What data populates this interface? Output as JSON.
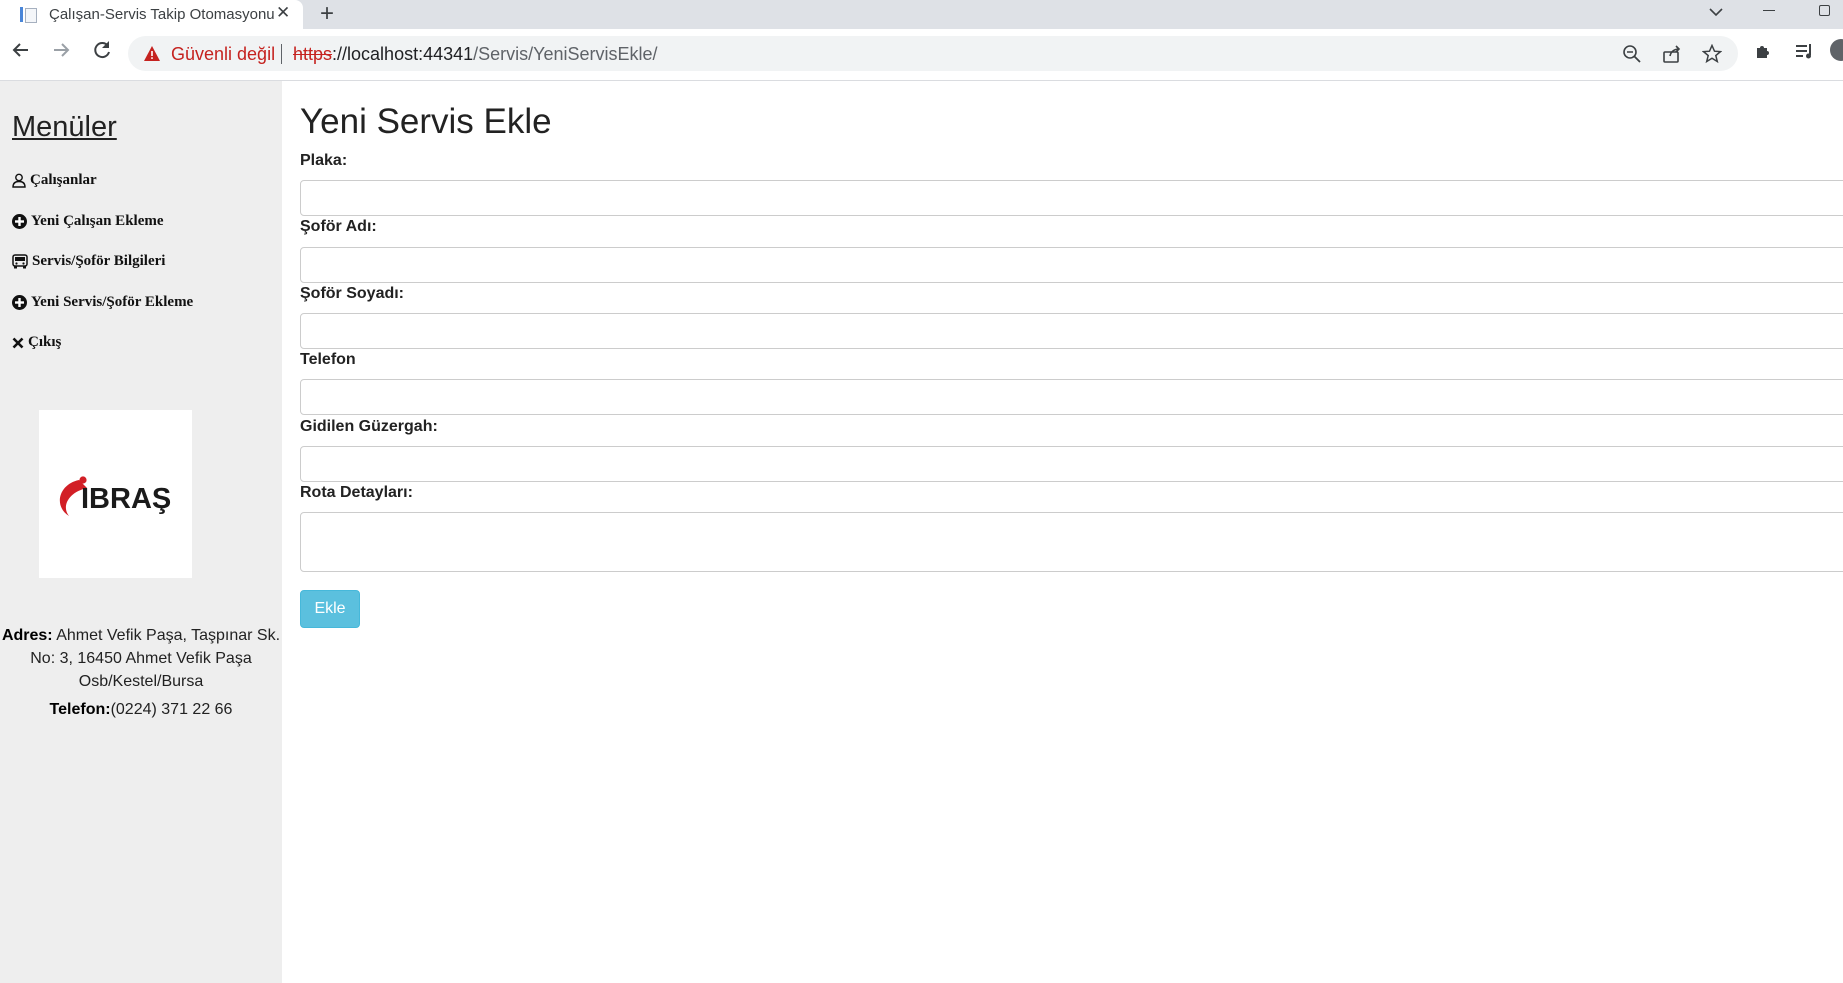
{
  "browser": {
    "tab_title": "Çalışan-Servis Takip Otomasyonu",
    "security_label": "Güvenli değil",
    "url_scheme": "https",
    "url_host": "://localhost:44341",
    "url_path": "/Servis/YeniServisEkle/"
  },
  "sidebar": {
    "title": "Menüler",
    "items": [
      {
        "label": "Çalışanlar",
        "icon": "user-icon"
      },
      {
        "label": "Yeni Çalışan Ekleme",
        "icon": "plus-circle-icon"
      },
      {
        "label": "Servis/Şoför Bilgileri",
        "icon": "bus-icon"
      },
      {
        "label": "Yeni Servis/Şoför Ekleme",
        "icon": "plus-circle-icon"
      },
      {
        "label": "Çıkış",
        "icon": "close-icon"
      }
    ],
    "logo_text": "IBRAŞ",
    "address_label": "Adres:",
    "address_line1": " Ahmet Vefik Paşa, Taşpınar Sk.",
    "address_line2": "No: 3, 16450 Ahmet Vefik Paşa",
    "address_line3": "Osb/Kestel/Bursa",
    "phone_label": "Telefon:",
    "phone_value": "(0224) 371 22 66"
  },
  "form": {
    "title": "Yeni Servis Ekle",
    "fields": [
      {
        "label": "Plaka:",
        "value": ""
      },
      {
        "label": "Şoför Adı:",
        "value": ""
      },
      {
        "label": "Şoför Soyadı:",
        "value": ""
      },
      {
        "label": "Telefon",
        "value": ""
      },
      {
        "label": "Gidilen Güzergah:",
        "value": ""
      },
      {
        "label": "Rota Detayları:",
        "value": ""
      }
    ],
    "submit_label": "Ekle"
  },
  "colors": {
    "sidebar_bg": "#eeeeee",
    "button_bg": "#5bc0de",
    "warning_red": "#c5221f"
  }
}
